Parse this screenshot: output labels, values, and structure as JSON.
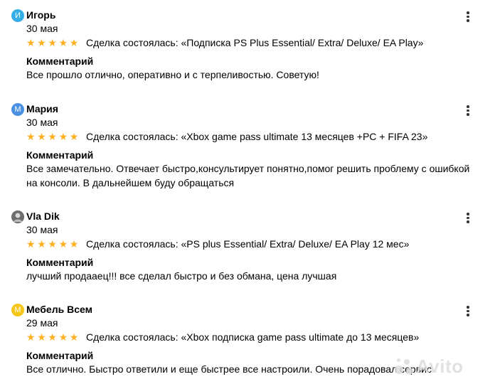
{
  "reviews": [
    {
      "author": "Игорь",
      "avatar_letter": "И",
      "avatar_color": "#33aee6",
      "date": "30 мая",
      "stars": 5,
      "deal": "Сделка состоялась: «Подписка PS Plus Essential/ Extra/ Deluxe/ EA Play»",
      "comment_heading": "Комментарий",
      "comment": "Все прошло отлично, оперативно и с терпеливостью. Советую!"
    },
    {
      "author": "Мария",
      "avatar_letter": "М",
      "avatar_color": "#4a90e2",
      "date": "30 мая",
      "stars": 5,
      "deal": "Сделка состоялась: «Xbox game pass ultimate 13 месяцев +PC + FIFA 23»",
      "comment_heading": "Комментарий",
      "comment": "Все замечательно. Отвечает быстро,консультирует понятно,помог решить проблему с ошибкой на консоли. В дальнейшем буду обращаться"
    },
    {
      "author": "Vla Dik",
      "avatar_letter": "",
      "avatar_color": "#8a8a8a",
      "date": "30 мая",
      "stars": 5,
      "deal": "Сделка состоялась: «PS plus Essential/ Extra/ Deluxe/ EA Play 12 мес»",
      "comment_heading": "Комментарий",
      "comment": "лучший продааец!!! все сделал быстро и без обмана, цена лучшая"
    },
    {
      "author": "Мебель Всем",
      "avatar_letter": "М",
      "avatar_color": "#f5c518",
      "date": "29 мая",
      "stars": 5,
      "deal": "Сделка состоялась: «Xbox подписка game pass ultimate до 13 месяцев»",
      "comment_heading": "Комментарий",
      "comment": "Все отлично. Быстро ответили и еще быстрее все настроили. Очень порадовал сервис"
    }
  ],
  "star_color": "#ffb021",
  "watermark": "Avito"
}
